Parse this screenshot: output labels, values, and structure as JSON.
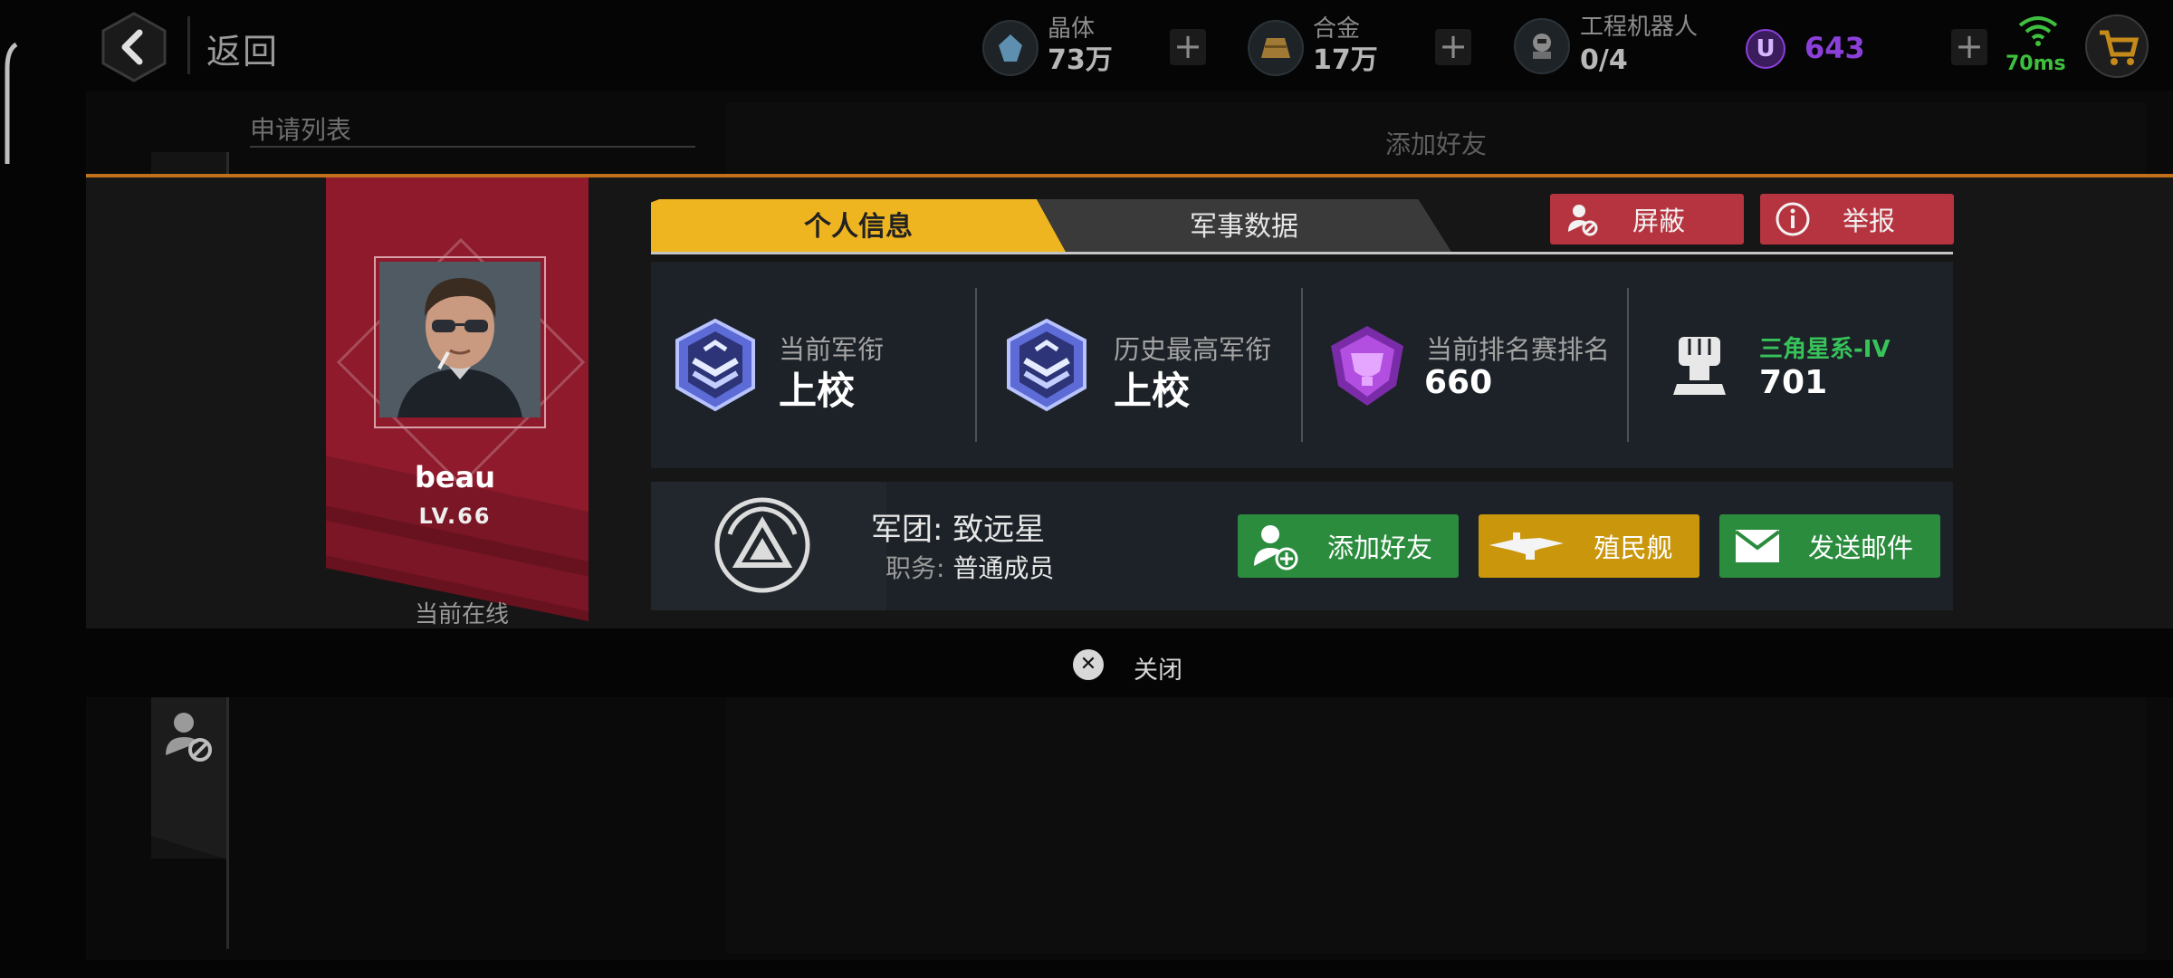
{
  "topbar": {
    "back_label": "返回",
    "resources": [
      {
        "name": "晶体",
        "value": "73万"
      },
      {
        "name": "合金",
        "value": "17万"
      },
      {
        "name": "工程机器人",
        "value": "0/4"
      }
    ],
    "currency": {
      "symbol": "U",
      "value": "643"
    },
    "ping": "70ms",
    "colors": {
      "currency": "#8b3fd9",
      "ping": "#3fbf3f"
    }
  },
  "background": {
    "apply_list_label": "申请列表",
    "add_friend_title": "添加好友"
  },
  "profile": {
    "name": "beau",
    "level": "LV.66",
    "status": "当前在线"
  },
  "tabs": {
    "personal": "个人信息",
    "military": "军事数据"
  },
  "actions_top": {
    "block": "屏蔽",
    "report": "举报"
  },
  "stats": {
    "current_rank": {
      "title": "当前军衔",
      "value": "上校"
    },
    "highest_rank": {
      "title": "历史最高军衔",
      "value": "上校"
    },
    "ranked": {
      "title": "当前排名赛排名",
      "value": "660"
    },
    "galaxy": {
      "title": "三角星系-IV",
      "value": "701"
    }
  },
  "legion": {
    "label": "军团:",
    "name": "致远星",
    "role_label": "职务:",
    "role": "普通成员"
  },
  "actions_bottom": {
    "add_friend": "添加好友",
    "colony_ship": "殖民舰",
    "send_mail": "发送邮件"
  },
  "close_label": "关闭"
}
